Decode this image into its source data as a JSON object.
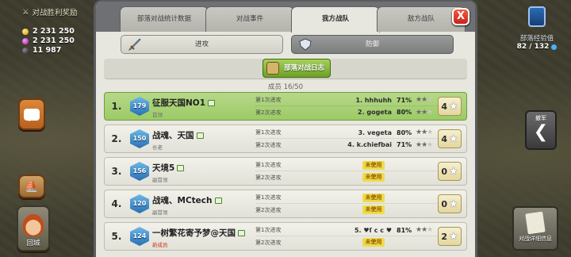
{
  "hud": {
    "war_reward_title": "对战胜利奖励",
    "gold": "2 231 250",
    "elixir": "2 231 250",
    "dark_elixir": "11 987",
    "xp_title": "部落经验值",
    "xp_value": "82 / 132",
    "back_label": "撤军",
    "home_label": "回城",
    "log_label": "对战详细信息"
  },
  "tabs": [
    {
      "label": "部落对战统计数据",
      "active": false
    },
    {
      "label": "对战事件",
      "active": false
    },
    {
      "label": "我方战队",
      "active": true
    },
    {
      "label": "敌方战队",
      "active": false
    }
  ],
  "close_label": "X",
  "mode": {
    "attack_label": "进攻",
    "defense_label": "防御"
  },
  "war_log_label": "部落对战日志",
  "member_count": "成员 16/50",
  "rows": [
    {
      "rank": "1.",
      "th": "179",
      "name": "征服天国NO1",
      "role": "首领",
      "highlight": true,
      "attacks": [
        {
          "label": "第1次进攻",
          "target": "1. hhhuhh",
          "pct": "71%",
          "stars": 2,
          "unused": ""
        },
        {
          "label": "第2次进攻",
          "target": "2. gogeta",
          "pct": "80%",
          "stars": 2,
          "unused": ""
        }
      ],
      "total_stars": "4"
    },
    {
      "rank": "2.",
      "th": "150",
      "name": "战魂、天国",
      "role": "长老",
      "highlight": false,
      "attacks": [
        {
          "label": "第1次进攻",
          "target": "3. vegeta",
          "pct": "80%",
          "stars": 2,
          "unused": ""
        },
        {
          "label": "第2次进攻",
          "target": "4. k.chiefbai",
          "pct": "71%",
          "stars": 2,
          "unused": ""
        }
      ],
      "total_stars": "4"
    },
    {
      "rank": "3.",
      "th": "156",
      "name": "天境5",
      "role": "副首领",
      "highlight": false,
      "attacks": [
        {
          "label": "第1次进攻",
          "target": "",
          "pct": "",
          "stars": 0,
          "unused": "未使用"
        },
        {
          "label": "第2次进攻",
          "target": "",
          "pct": "",
          "stars": 0,
          "unused": "未使用"
        }
      ],
      "total_stars": "0"
    },
    {
      "rank": "4.",
      "th": "120",
      "name": "战魂、MCtech",
      "role": "副首领",
      "highlight": false,
      "attacks": [
        {
          "label": "第1次进攻",
          "target": "",
          "pct": "",
          "stars": 0,
          "unused": "未使用"
        },
        {
          "label": "第2次进攻",
          "target": "",
          "pct": "",
          "stars": 0,
          "unused": "未使用"
        }
      ],
      "total_stars": "0"
    },
    {
      "rank": "5.",
      "th": "124",
      "name": "一树繁花寄予梦@天国",
      "role": "新成员",
      "role_red": true,
      "highlight": false,
      "attacks": [
        {
          "label": "第1次进攻",
          "target": "5. ♥ſ c c ♥",
          "pct": "81%",
          "stars": 2,
          "unused": ""
        },
        {
          "label": "第2次进攻",
          "target": "",
          "pct": "",
          "stars": 0,
          "unused": "未使用"
        }
      ],
      "total_stars": "2"
    }
  ],
  "colors": {
    "active_tab": "#e8e7df",
    "highlight_row": "#9ccb67",
    "log_button": "#6ea126",
    "close_button": "#c8231b"
  }
}
